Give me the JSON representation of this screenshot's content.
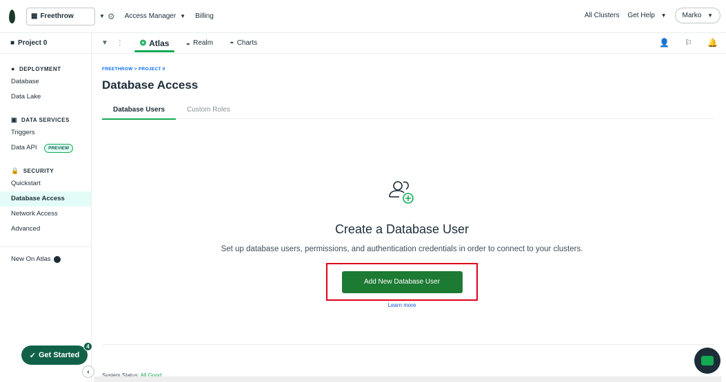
{
  "topbar": {
    "org_name": "Freethrow",
    "access_manager": "Access Manager",
    "billing": "Billing",
    "all_clusters": "All Clusters",
    "get_help": "Get Help",
    "user": "Marko"
  },
  "projbar": {
    "project": "Project 0",
    "tabs": [
      {
        "label": "Atlas",
        "icon": "atlas-icon"
      },
      {
        "label": "Realm",
        "icon": "realm-icon"
      },
      {
        "label": "Charts",
        "icon": "charts-icon"
      }
    ]
  },
  "sidebar": {
    "deployment": "DEPLOYMENT",
    "database": "Database",
    "data_lake": "Data Lake",
    "data_services": "DATA SERVICES",
    "triggers": "Triggers",
    "data_api": "Data API",
    "preview": "PREVIEW",
    "security": "SECURITY",
    "quickstart": "Quickstart",
    "database_access": "Database Access",
    "network_access": "Network Access",
    "advanced": "Advanced",
    "new_on_atlas": "New On Atlas",
    "get_started": "Get Started",
    "get_started_count": "4"
  },
  "main": {
    "breadcrumb": "FREETHROW > PROJECT 0",
    "title": "Database Access",
    "tabs": [
      "Database Users",
      "Custom Roles"
    ],
    "empty_title": "Create a Database User",
    "empty_text": "Set up database users, permissions, and authentication credentials in order to connect to your clusters.",
    "add_button": "Add New Database User",
    "learn_more": "Learn more"
  },
  "footer": {
    "status_label": "System Status:",
    "status_value": "All Good"
  },
  "colors": {
    "brand_green": "#13aa52",
    "button_green": "#1d7a33",
    "highlight_red": "#e0001a"
  }
}
